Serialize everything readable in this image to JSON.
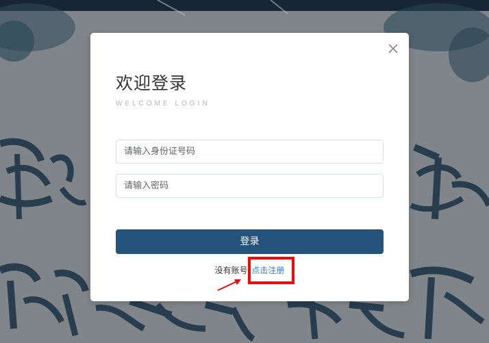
{
  "modal": {
    "title": "欢迎登录",
    "subtitle": "WELCOME LOGIN",
    "id_field": {
      "placeholder": "请输入身份证号码",
      "value": ""
    },
    "password_field": {
      "placeholder": "请输入密码",
      "value": ""
    },
    "login_label": "登录",
    "no_account_text": "没有账号",
    "register_link": "点击注册"
  },
  "colors": {
    "primary_button": "#26537c",
    "link": "#2e7ad0",
    "highlight": "#ee0a0a"
  },
  "icons": {
    "close": "close-icon",
    "arrow": "arrow-icon"
  }
}
